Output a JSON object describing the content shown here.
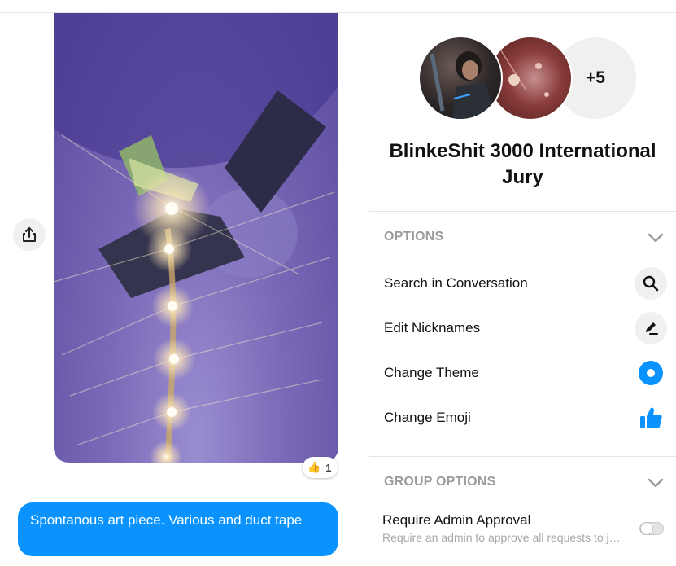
{
  "chat": {
    "reaction": {
      "emoji": "👍",
      "count": "1"
    },
    "message": "Spontanous art piece. Various and duct tape"
  },
  "sidebar": {
    "avatars": {
      "more_count": "+5"
    },
    "group_name": "BlinkeShit 3000 International Jury",
    "options": {
      "heading": "OPTIONS",
      "items": [
        {
          "label": "Search in Conversation",
          "icon": "search-icon"
        },
        {
          "label": "Edit Nicknames",
          "icon": "pencil-icon"
        },
        {
          "label": "Change Theme",
          "icon": "theme-icon"
        },
        {
          "label": "Change Emoji",
          "icon": "thumbs-up-icon"
        }
      ]
    },
    "group_options": {
      "heading": "GROUP OPTIONS",
      "require_admin_label": "Require Admin Approval",
      "require_admin_desc": "Require an admin to approve all requests to j…",
      "require_admin_enabled": false
    }
  },
  "colors": {
    "accent": "#0a93ff",
    "heading_gray": "#9b9b9b"
  }
}
